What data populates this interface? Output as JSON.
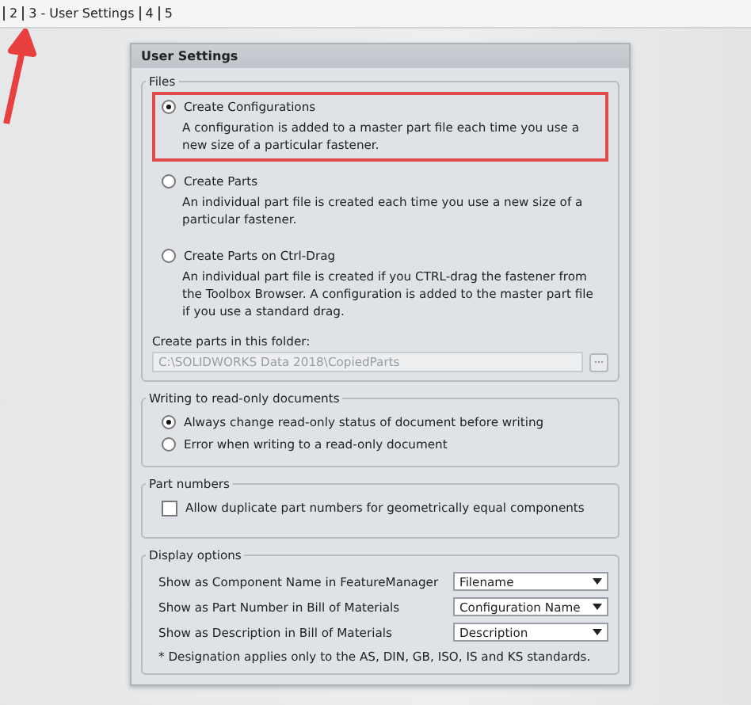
{
  "breadcrumb": [
    {
      "label": "2"
    },
    {
      "label": "3 - User Settings"
    },
    {
      "label": "4"
    },
    {
      "label": "5"
    }
  ],
  "dialog": {
    "title": "User Settings",
    "files": {
      "legend": "Files",
      "options": [
        {
          "label": "Create Configurations",
          "description": "A configuration is added to a master part file each time you use a new size of a particular fastener.",
          "selected": true,
          "highlighted": true
        },
        {
          "label": "Create Parts",
          "description": "An individual part file is created each time you use a new size of a particular fastener.",
          "selected": false,
          "highlighted": false
        },
        {
          "label": "Create Parts on Ctrl-Drag",
          "description": "An individual part file is created if you CTRL-drag the fastener from the Toolbox Browser. A configuration is added to the master part file if you use a standard drag.",
          "selected": false,
          "highlighted": false
        }
      ],
      "folder_label": "Create parts in this folder:",
      "folder_value": "C:\\SOLIDWORKS Data 2018\\CopiedParts",
      "folder_disabled": true
    },
    "writing": {
      "legend": "Writing to read-only documents",
      "options": [
        {
          "label": "Always change read-only status of document before writing",
          "selected": true
        },
        {
          "label": "Error when writing to a read-only document",
          "selected": false
        }
      ]
    },
    "part_numbers": {
      "legend": "Part numbers",
      "label": "Allow duplicate part numbers for geometrically equal components",
      "checked": false
    },
    "display": {
      "legend": "Display options",
      "rows": [
        {
          "label": "Show as Component Name in FeatureManager",
          "value": "Filename"
        },
        {
          "label": "Show as Part Number in Bill of Materials",
          "value": "Configuration Name"
        },
        {
          "label": "Show as Description in Bill of Materials",
          "value": "Description"
        }
      ],
      "note": "* Designation applies only to the AS, DIN, GB, ISO, IS and KS standards."
    }
  },
  "annotation": {
    "arrow": true
  }
}
